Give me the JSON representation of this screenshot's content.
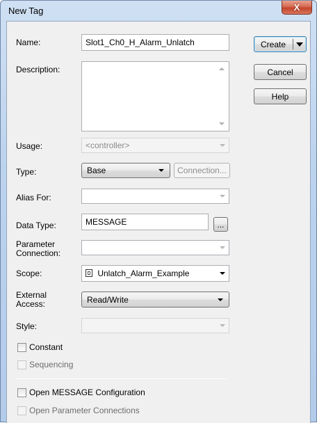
{
  "window": {
    "title": "New Tag",
    "close_glyph": "X"
  },
  "buttons": {
    "create": "Create",
    "cancel": "Cancel",
    "help": "Help",
    "connection": "Connection...",
    "browse": "..."
  },
  "fields": {
    "name": {
      "label": "Name:",
      "value": "Slot1_Ch0_H_Alarm_Unlatch"
    },
    "description": {
      "label": "Description:",
      "value": ""
    },
    "usage": {
      "label": "Usage:",
      "value": "<controller>"
    },
    "type": {
      "label": "Type:",
      "value": "Base"
    },
    "alias_for": {
      "label": "Alias For:",
      "value": ""
    },
    "data_type": {
      "label": "Data Type:",
      "value": "MESSAGE"
    },
    "parameter_connection": {
      "label_line1": "Parameter",
      "label_line2": "Connection:",
      "value": ""
    },
    "scope": {
      "label": "Scope:",
      "value": "Unlatch_Alarm_Example",
      "icon": "program-scope-icon"
    },
    "external_access": {
      "label_line1": "External",
      "label_line2": "Access:",
      "value": "Read/Write"
    },
    "style": {
      "label": "Style:",
      "value": ""
    }
  },
  "checkboxes": {
    "constant": {
      "label": "Constant",
      "checked": false
    },
    "sequencing": {
      "label": "Sequencing",
      "checked": false,
      "enabled": false
    },
    "open_config": {
      "label": "Open MESSAGE Configuration",
      "checked": false
    },
    "open_param": {
      "label": "Open Parameter Connections",
      "checked": false,
      "enabled": false
    }
  },
  "colors": {
    "title_bar": "#bcd3ee",
    "client_bg": "#f0f0f0",
    "close_button": "#c3452a"
  }
}
